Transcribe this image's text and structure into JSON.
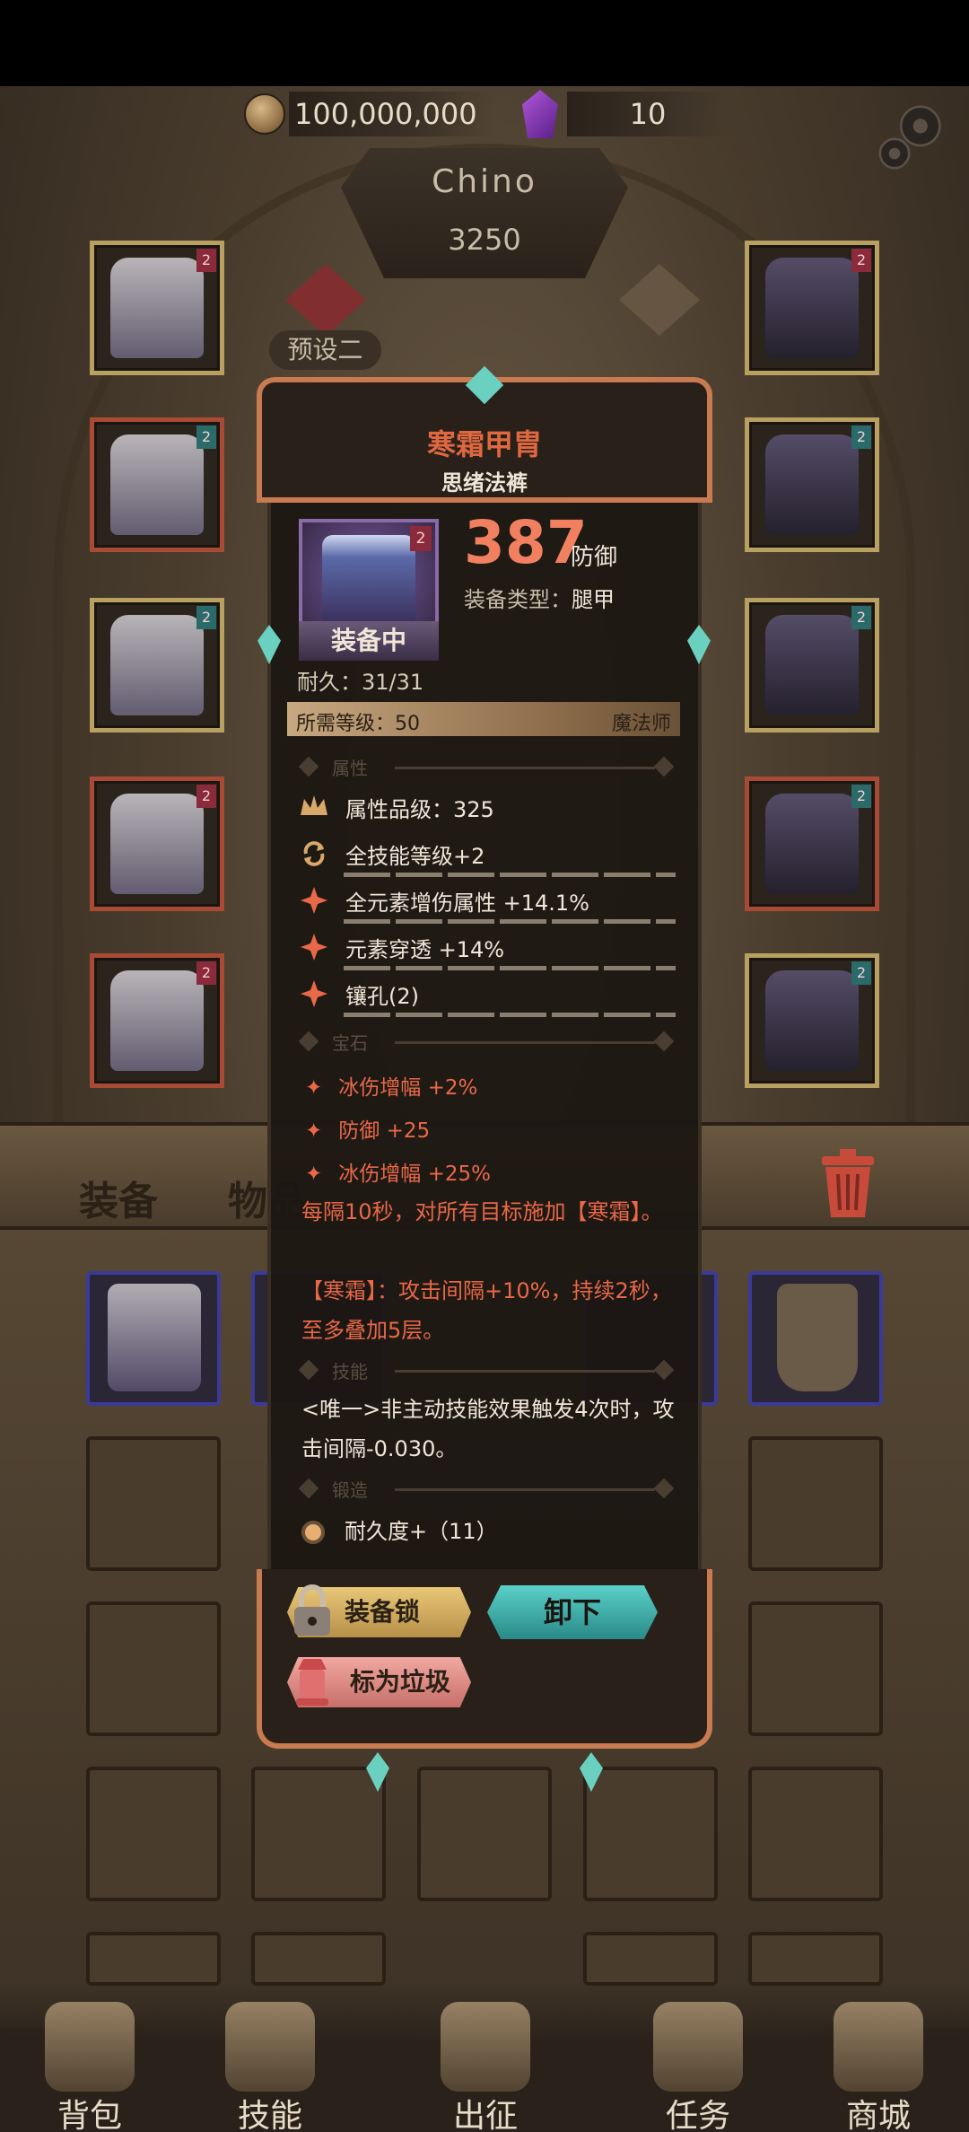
{
  "currency": {
    "coins": "100,000,000",
    "gems": "10"
  },
  "player": {
    "name": "Chino",
    "power": "3250"
  },
  "preset": {
    "label": "预设二"
  },
  "tabs": {
    "equipment": "装备",
    "items": "物品"
  },
  "nav": [
    {
      "label": "背包",
      "icon": "backpack-icon"
    },
    {
      "label": "技能",
      "icon": "skill-book-icon"
    },
    {
      "label": "出征",
      "icon": "sword-icon"
    },
    {
      "label": "任务",
      "icon": "scroll-icon"
    },
    {
      "label": "商城",
      "icon": "shop-crown-icon"
    }
  ],
  "item": {
    "name": "寒霜甲胄",
    "subtitle": "思绪法裤",
    "level_badge": "2",
    "equipped_label": "装备中",
    "stat_value": "387",
    "stat_label": "防御",
    "type_label": "装备类型：",
    "type_value": "腿甲",
    "durability": "耐久：31/31",
    "required_level": "所需等级：50",
    "required_class": "魔法师",
    "sections": {
      "attributes": "属性",
      "gems": "宝石",
      "skill": "技能",
      "forge": "锻造"
    },
    "attributes": [
      {
        "text": "属性品级：325",
        "icon": "quality-crown-icon"
      },
      {
        "text": "全技能等级+2",
        "icon": "cycle-icon"
      },
      {
        "text": "全元素增伤属性 +14.1%",
        "icon": "element-spark-icon"
      },
      {
        "text": "元素穿透 +14%",
        "icon": "element-spark-icon"
      },
      {
        "text": "镶孔(2)",
        "icon": "socket-icon"
      }
    ],
    "gems": [
      {
        "text": "冰伤增幅 +2%"
      },
      {
        "text": "防御 +25"
      },
      {
        "text": "冰伤增幅 +25%"
      }
    ],
    "effect_text": "每隔10秒，对所有目标施加【寒霜】。",
    "frost_text": "【寒霜】：攻击间隔+10%，持续2秒，至多叠加5层。",
    "skill_text": "<唯一>非主动技能效果触发4次时，攻击间隔-0.030。",
    "forge": [
      {
        "text": "耐久度+（11）"
      }
    ]
  },
  "buttons": {
    "lock": "装备锁",
    "unequip": "卸下",
    "junk": "标为垃圾"
  },
  "colors": {
    "item_name": "#e06840",
    "stat_value": "#f08060",
    "accent_teal": "#5ad0c8",
    "frame_copper": "#c87a50",
    "gem_text": "#e86848"
  }
}
